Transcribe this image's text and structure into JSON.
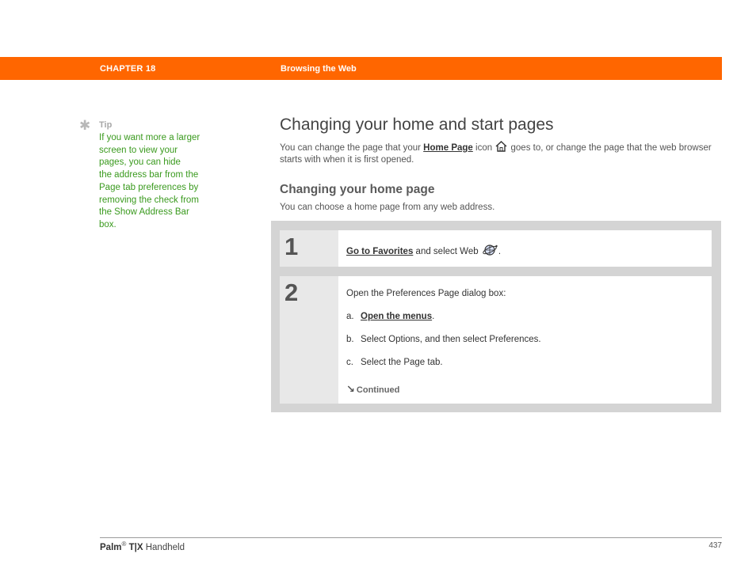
{
  "header": {
    "chapter": "CHAPTER 18",
    "title": "Browsing the Web",
    "bar_color": "#ff6600"
  },
  "tip": {
    "icon": "asterisk-icon",
    "label": "Tip",
    "lines": [
      "If you want more a larger",
      "screen to view your",
      "pages, you can hide",
      "the address bar from the",
      "Page tab preferences by",
      "removing the check from",
      "the Show Address Bar",
      "box."
    ],
    "text_color": "#3a9a1e"
  },
  "main": {
    "heading": "Changing your home and start pages",
    "intro_before": "You can change the page that your ",
    "intro_link": "Home Page",
    "intro_mid": " icon ",
    "intro_icon": "home-icon",
    "intro_after": " goes to, or change the page that the web browser starts with when it is first opened.",
    "subheading": "Changing your home page",
    "subtext": "You can choose a home page from any web address."
  },
  "steps": [
    {
      "number": "1",
      "link": "Go to Favorites",
      "text": " and select Web ",
      "icon": "web-browser-icon",
      "end": "."
    },
    {
      "number": "2",
      "intro": "Open the Preferences Page dialog box:",
      "a_letter": "a.",
      "a_link": "Open the menus",
      "a_end": ".",
      "b_letter": "b.",
      "b_text": "Select Options, and then select Preferences.",
      "c_letter": "c.",
      "c_text": "Select the Page tab.",
      "continued": "Continued",
      "continued_icon": "continued-arrow-icon"
    }
  ],
  "footer": {
    "brand": "Palm",
    "reg": "®",
    "model": "T|X",
    "product": " Handheld",
    "page": "437"
  }
}
